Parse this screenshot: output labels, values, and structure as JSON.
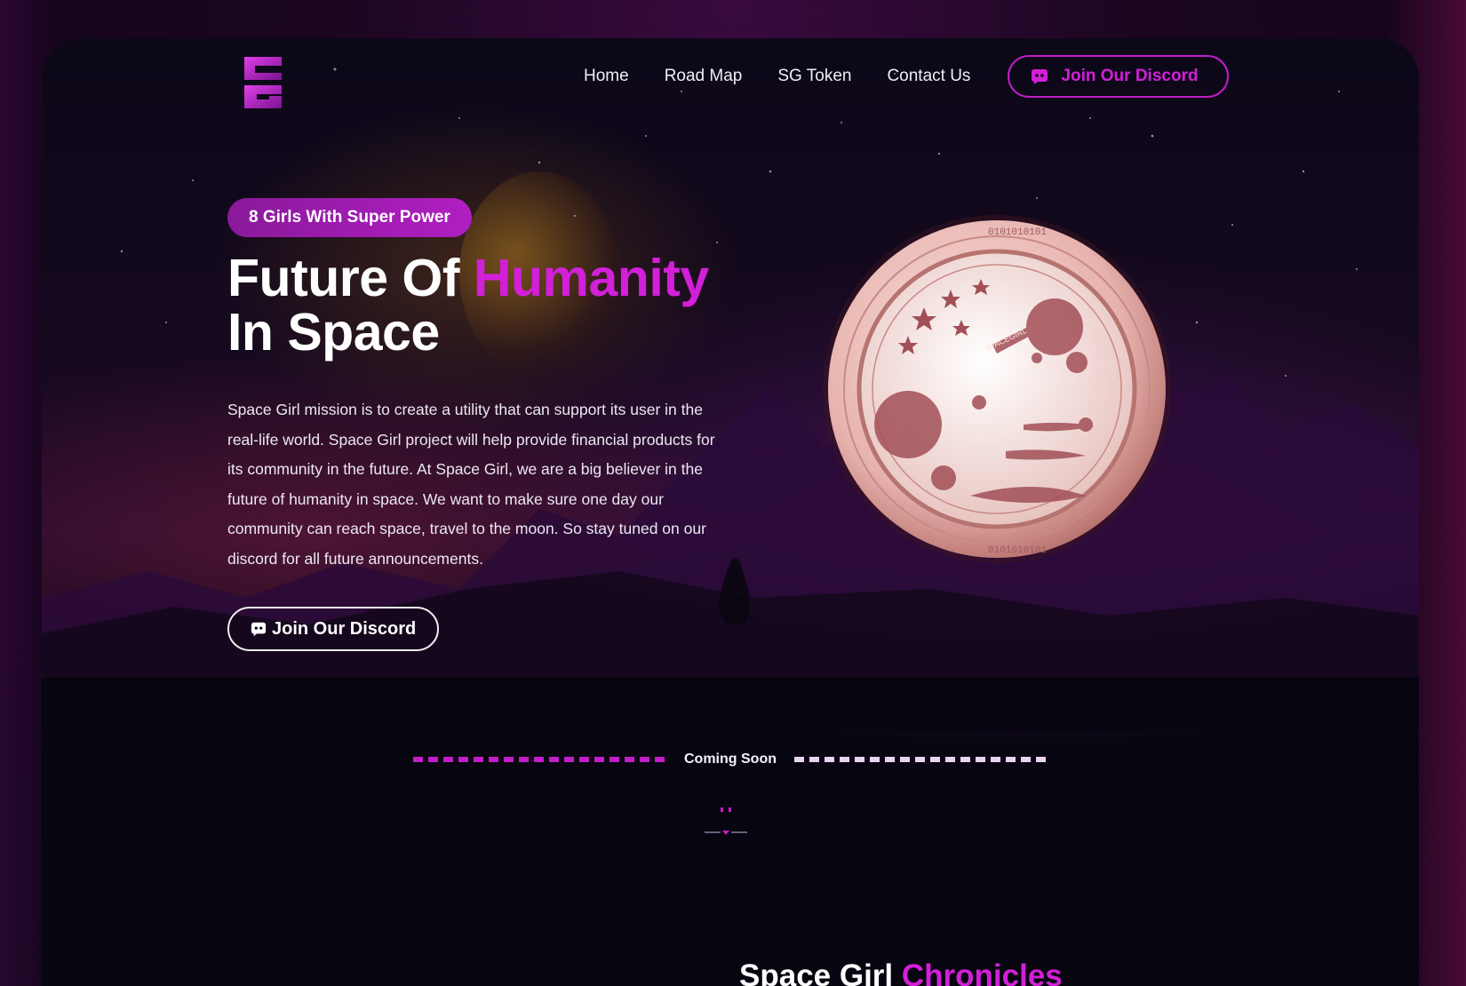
{
  "nav": {
    "links": [
      "Home",
      "Road Map",
      "SG Token",
      "Contact Us"
    ],
    "discord_label": "Join Our Discord"
  },
  "hero": {
    "badge": "8 Girls With Super Power",
    "title_part1": "Future Of ",
    "title_accent": "Humanity",
    "title_line2": "In Space",
    "description": "Space Girl mission is to create a utility that can support its user in the real-life world. Space Girl project will help provide financial products for its community in the future. At Space Girl, we are a big believer in the future of humanity in space. We want to make sure one day our community can reach space, travel to the moon. So stay tuned on our discord for all future announcements.",
    "discord_label": "Join Our Discord",
    "coin_text": "SPACEGIRL"
  },
  "coming_soon": "Coming Soon",
  "chronicles": {
    "part1": "Space Girl ",
    "accent": "Chronicles"
  },
  "colors": {
    "accent": "#d21fd8",
    "background": "#07050f",
    "coin": "#e8b4b0"
  },
  "icons": [
    "logo-icon",
    "discord-icon",
    "scroll-down-icon",
    "coin-emblem"
  ]
}
